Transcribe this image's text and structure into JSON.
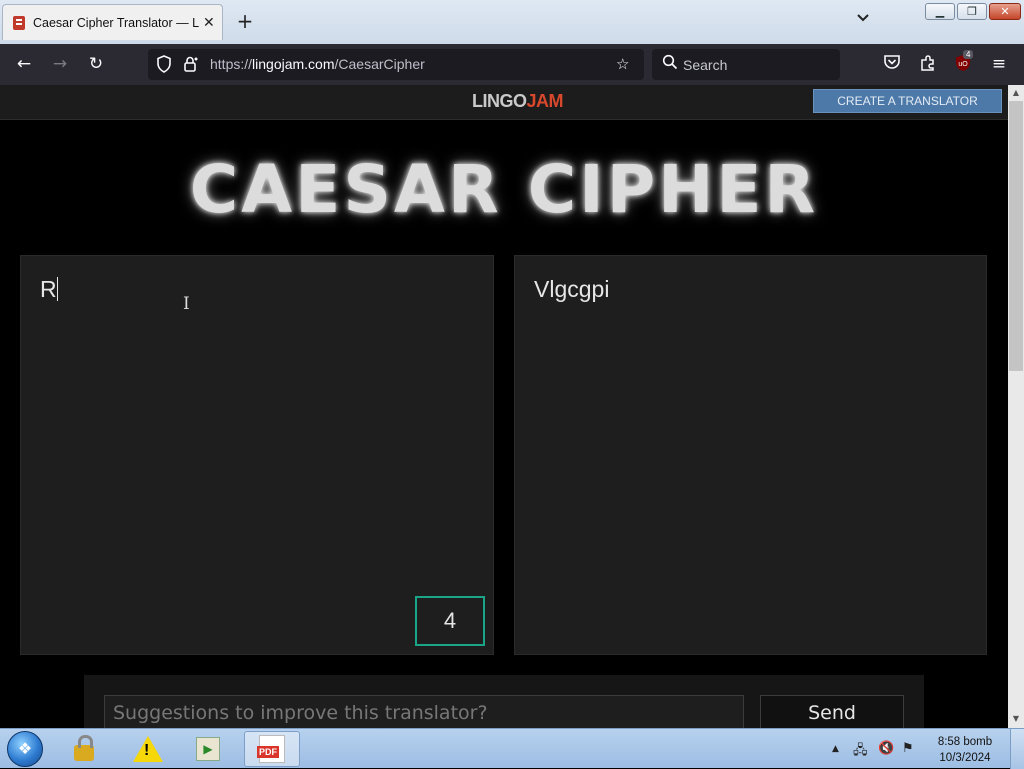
{
  "browser": {
    "tab_title": "Caesar Cipher Translator — Lingojam",
    "new_tab_icon": "plus-icon",
    "url_prefix": "https://",
    "url_host": "lingojam.com",
    "url_path": "/CaesarCipher",
    "search_placeholder": "Search",
    "extension_badge": "4",
    "window_controls": {
      "minimize": "minimize-icon",
      "maximize": "maximize-icon",
      "close": "close-icon"
    }
  },
  "site": {
    "logo_part1": "LINGO",
    "logo_part2": "JAM",
    "create_button": "CREATE A TRANSLATOR",
    "heading": "CAESAR CIPHER",
    "input_text": "R",
    "output_text": "Vlgcgpi",
    "shift_value": "4",
    "suggest_placeholder": "Suggestions to improve this translator?",
    "send_label": "Send"
  },
  "taskbar": {
    "clock_time": "8:58 bomb",
    "clock_date": "10/3/2024",
    "pinned": [
      "lock-icon",
      "warning-icon",
      "media-player-icon",
      "pdf-icon"
    ]
  },
  "colors": {
    "accent_teal": "#1aa589",
    "logo_red": "#d8482c",
    "create_button_blue": "#4d79a8",
    "page_bg": "#000000",
    "panel_bg": "#1e1e1e"
  }
}
